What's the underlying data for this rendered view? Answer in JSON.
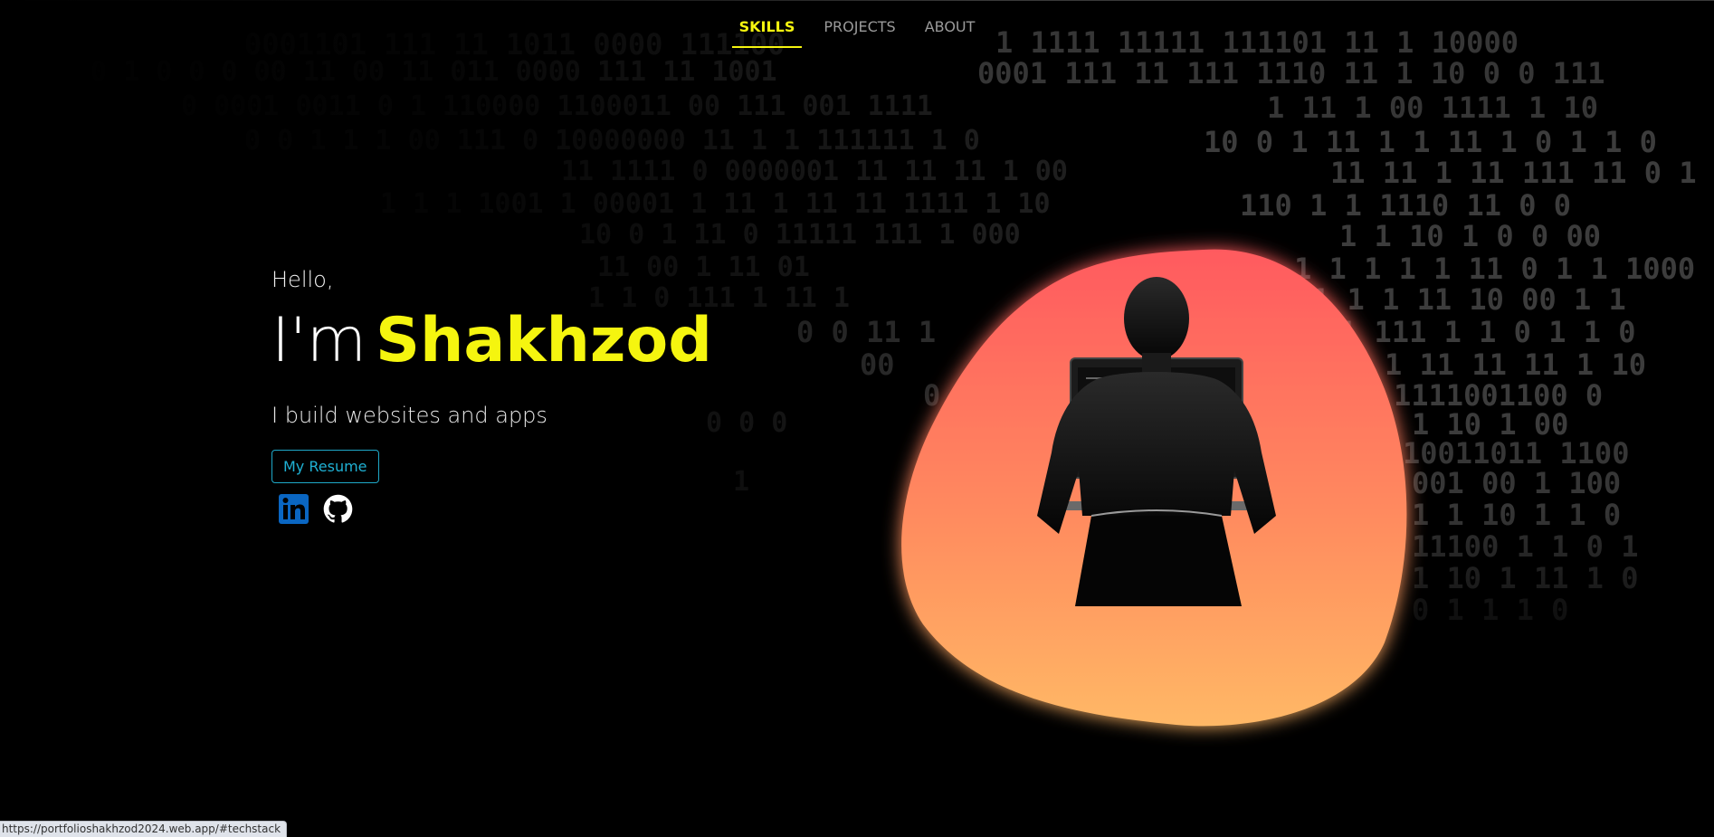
{
  "nav": {
    "items": [
      {
        "label": "SKILLS",
        "active": true
      },
      {
        "label": "PROJECTS",
        "active": false
      },
      {
        "label": "ABOUT",
        "active": false
      }
    ]
  },
  "hero": {
    "greeting": "Hello,",
    "title_prefix": "I'm",
    "name": "Shakhzod",
    "tagline": "I build websites and apps",
    "resume_button": "My Resume"
  },
  "socials": [
    {
      "name": "linkedin-icon",
      "color": "#0a66c2"
    },
    {
      "name": "github-icon",
      "color": "#ffffff"
    }
  ],
  "status_bar": {
    "url": "https://portfolioshakhzod2024.web.app/#techstack"
  },
  "colors": {
    "accent": "#f5f50f",
    "button": "#1fb1d4",
    "blob_top": "#ff5a5f",
    "blob_bottom": "#ffb866"
  }
}
